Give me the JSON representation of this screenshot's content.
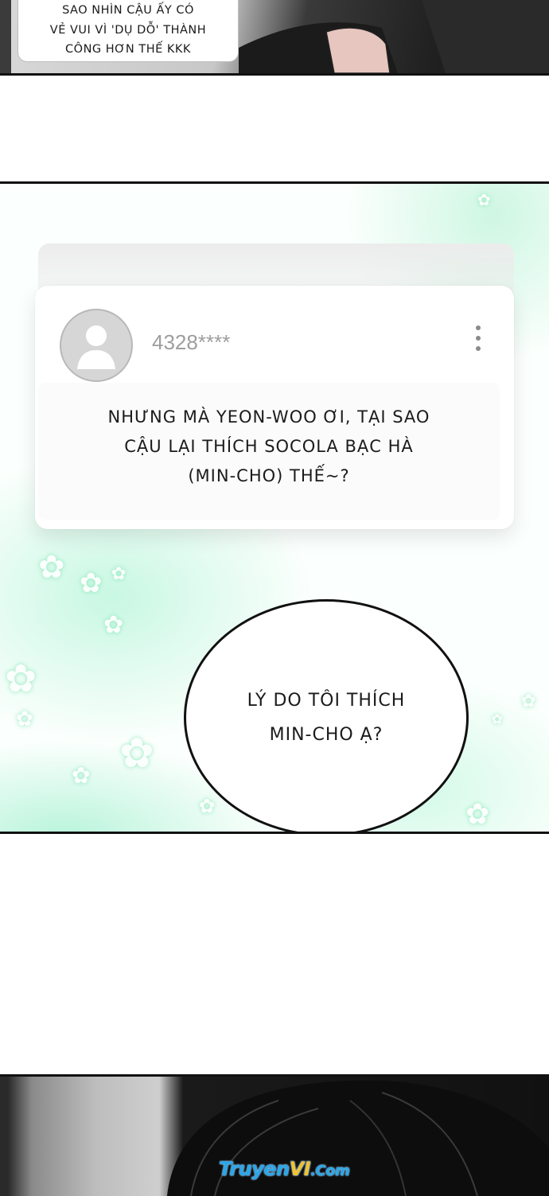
{
  "top_panel": {
    "bubble_lines": [
      "SAO NHÌN CẬU ẤY CÓ",
      "VẺ VUI VÌ 'DỤ DỖ' THÀNH",
      "CÔNG HƠN THẾ KKK"
    ]
  },
  "comment": {
    "avatar_icon": "user-silhouette-icon",
    "username": "4328****",
    "more_icon": "more-vertical-icon",
    "lines": [
      "NHƯNG MÀ YEON-WOO ƠI, TẠI SAO",
      "CẬU LẠI THÍCH SOCOLA BẠC HÀ",
      "(MIN-CHO) THẾ~?"
    ]
  },
  "speech": {
    "lines": [
      "LÝ DO TÔI THÍCH",
      "MIN-CHO Ạ?"
    ]
  },
  "watermark": {
    "part1": "Truyen",
    "part2": "VI",
    "part3": ".Com",
    "colors": {
      "part1": "#2aa7e8",
      "part2": "#f2c230",
      "part3": "#2aa7e8"
    }
  },
  "colors": {
    "accent_green": "#8fe9c0",
    "border": "#111111",
    "text": "#1b1b1b",
    "username": "#9e9e9e"
  }
}
